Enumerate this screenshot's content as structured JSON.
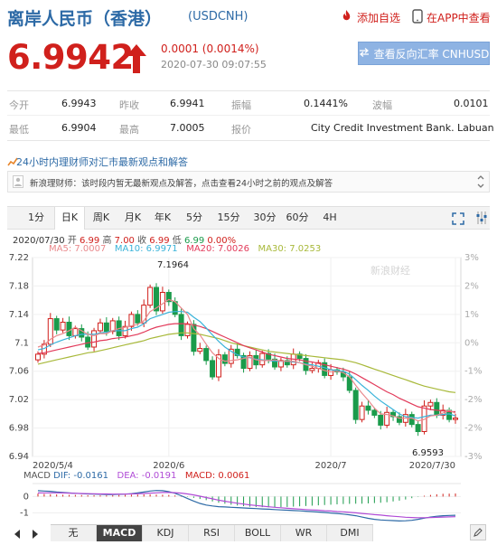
{
  "header": {
    "title": "离岸人民币（香港）",
    "code": "(USDCNH)",
    "add_watch": "添加自选",
    "app_view": "在APP中查看"
  },
  "quote": {
    "price": "6.9942",
    "change": "0.0001 (0.0014%)",
    "time": "2020-07-30 09:07:55",
    "reverse_button": "查看反向汇率 CNHUSD"
  },
  "stats": {
    "open_label": "今开",
    "open": "6.9943",
    "prev_close_label": "昨收",
    "prev_close": "6.9941",
    "amplitude_label": "振幅",
    "amplitude": "0.1441%",
    "volatility_label": "波幅",
    "volatility": "0.0101",
    "low_label": "最低",
    "low": "6.9904",
    "high_label": "最高",
    "high": "7.0005",
    "quoter_label": "报价",
    "quoter": "City Credit Investment Bank. Labuan"
  },
  "advisory": {
    "title": "24小时内理财师对汇市最新观点和解答",
    "message": "新浪理财师：该时段内暂无最新观点及解答，点击查看24小时之前的观点及解答"
  },
  "tabs": [
    "1分",
    "日K",
    "周K",
    "月K",
    "年K",
    "5分",
    "15分",
    "30分",
    "60分",
    "4H"
  ],
  "active_tab": "日K",
  "kline_info": {
    "date": "2020/07/30",
    "open_label": "开",
    "open": "6.99",
    "high_label": "高",
    "high": "7.00",
    "close_label": "收",
    "close": "6.99",
    "low_label": "低",
    "low": "6.99",
    "change": "0.00%",
    "ma5": "MA5: 7.0007",
    "ma10": "MA10: 6.9971",
    "ma20": "MA20: 7.0026",
    "ma30": "MA30: 7.0253"
  },
  "macd_info": {
    "label": "MACD",
    "dif": "DIF: -0.0161",
    "dea": "DEA: -0.0191",
    "macd": "MACD: 0.0061"
  },
  "watermark": "新浪财经",
  "indicator_tabs": [
    "无",
    "MACD",
    "KDJ",
    "RSI",
    "BOLL",
    "WR",
    "DMI"
  ],
  "active_indicator": "MACD",
  "colors": {
    "up": "#d0201c",
    "down": "#1a9b4b",
    "ma5": "#e9898c",
    "ma10": "#3ab3d9",
    "ma20": "#e23a5a",
    "ma30": "#a8b93a",
    "link": "#2d6aa6"
  },
  "chart_data": [
    {
      "type": "candlestick",
      "y_ticks": [
        "7.22",
        "7.18",
        "7.14",
        "7.1",
        "7.06",
        "7.02",
        "6.98",
        "6.94"
      ],
      "y_right_ticks": [
        "3%",
        "2%",
        "1%",
        "0%",
        "-1%",
        "-2%",
        "-2%",
        "-3%"
      ],
      "x_ticks": [
        "2020/5/4",
        "2020/6",
        "2020/7",
        "2020/7/30"
      ],
      "ylim": [
        6.94,
        7.22
      ],
      "annotations": {
        "max": "7.1964",
        "min": "6.9593"
      },
      "close": [
        7.084,
        7.098,
        7.134,
        7.118,
        7.129,
        7.11,
        7.12,
        7.108,
        7.094,
        7.117,
        7.128,
        7.116,
        7.131,
        7.11,
        7.123,
        7.14,
        7.128,
        7.153,
        7.178,
        7.145,
        7.171,
        7.158,
        7.14,
        7.11,
        7.126,
        7.088,
        7.092,
        7.075,
        7.052,
        7.083,
        7.071,
        7.091,
        7.082,
        7.064,
        7.082,
        7.069,
        7.085,
        7.077,
        7.066,
        7.075,
        7.069,
        7.084,
        7.078,
        7.061,
        7.064,
        7.072,
        7.054,
        7.062,
        7.059,
        7.052,
        7.033,
        6.992,
        7.011,
        7.005,
        6.998,
        6.984,
        7.002,
        6.996,
        6.988,
        6.999,
        6.985,
        6.975,
        7.011,
        7.016,
        6.998,
        7.005,
        6.992,
        6.994
      ],
      "ma5": [
        7.094,
        7.097,
        7.105,
        7.11,
        7.113,
        7.117,
        7.122,
        7.117,
        7.112,
        7.11,
        7.113,
        7.113,
        7.117,
        7.12,
        7.122,
        7.124,
        7.126,
        7.131,
        7.144,
        7.149,
        7.155,
        7.161,
        7.158,
        7.149,
        7.14,
        7.12,
        7.111,
        7.098,
        7.086,
        7.078,
        7.074,
        7.075,
        7.076,
        7.078,
        7.08,
        7.076,
        7.075,
        7.075,
        7.076,
        7.074,
        7.074,
        7.074,
        7.072,
        7.069,
        7.067,
        7.064,
        7.061,
        7.059,
        7.06,
        7.058,
        7.052,
        7.04,
        7.029,
        7.019,
        7.008,
        7.0,
        6.999,
        6.997,
        6.994,
        6.994,
        6.994,
        6.99,
        6.992,
        6.997,
        6.998,
        7.001,
        7.005,
        7.001
      ],
      "ma10": [
        7.09,
        7.092,
        7.097,
        7.101,
        7.104,
        7.107,
        7.11,
        7.112,
        7.112,
        7.112,
        7.114,
        7.115,
        7.117,
        7.117,
        7.117,
        7.12,
        7.122,
        7.127,
        7.134,
        7.137,
        7.14,
        7.143,
        7.144,
        7.144,
        7.143,
        7.136,
        7.13,
        7.121,
        7.111,
        7.102,
        7.094,
        7.088,
        7.083,
        7.08,
        7.079,
        7.077,
        7.076,
        7.075,
        7.074,
        7.074,
        7.074,
        7.073,
        7.072,
        7.07,
        7.069,
        7.067,
        7.065,
        7.062,
        7.061,
        7.06,
        7.056,
        7.048,
        7.04,
        7.033,
        7.025,
        7.018,
        7.012,
        7.006,
        7.0,
        6.996,
        6.995,
        6.994,
        6.996,
        6.998,
        6.998,
        6.999,
        7.0,
        6.997
      ],
      "ma20": [
        7.085,
        7.086,
        7.088,
        7.09,
        7.092,
        7.094,
        7.096,
        7.098,
        7.1,
        7.101,
        7.103,
        7.104,
        7.106,
        7.107,
        7.108,
        7.11,
        7.112,
        7.115,
        7.119,
        7.122,
        7.124,
        7.126,
        7.127,
        7.127,
        7.127,
        7.125,
        7.123,
        7.12,
        7.116,
        7.112,
        7.108,
        7.104,
        7.1,
        7.096,
        7.093,
        7.09,
        7.087,
        7.084,
        7.082,
        7.08,
        7.078,
        7.077,
        7.076,
        7.074,
        7.073,
        7.071,
        7.069,
        7.067,
        7.065,
        7.063,
        7.06,
        7.056,
        7.051,
        7.046,
        7.041,
        7.036,
        7.031,
        7.027,
        7.022,
        7.018,
        7.014,
        7.01,
        7.008,
        7.006,
        7.005,
        7.004,
        7.003,
        7.003
      ],
      "ma30": [
        7.07,
        7.072,
        7.074,
        7.076,
        7.078,
        7.08,
        7.082,
        7.084,
        7.086,
        7.087,
        7.089,
        7.091,
        7.093,
        7.095,
        7.097,
        7.099,
        7.101,
        7.103,
        7.106,
        7.108,
        7.11,
        7.112,
        7.113,
        7.114,
        7.114,
        7.113,
        7.112,
        7.11,
        7.108,
        7.106,
        7.103,
        7.1,
        7.098,
        7.096,
        7.094,
        7.092,
        7.09,
        7.088,
        7.087,
        7.086,
        7.085,
        7.084,
        7.083,
        7.082,
        7.081,
        7.08,
        7.079,
        7.078,
        7.077,
        7.076,
        7.074,
        7.072,
        7.069,
        7.066,
        7.063,
        7.06,
        7.057,
        7.054,
        7.051,
        7.048,
        7.045,
        7.042,
        7.039,
        7.037,
        7.035,
        7.033,
        7.031,
        7.03
      ]
    },
    {
      "type": "macd",
      "y_ticks": [
        "0",
        "-1"
      ],
      "ylim": [
        -1.7,
        0.8
      ],
      "hist": [
        0.18,
        0.16,
        0.14,
        0.13,
        0.11,
        0.1,
        0.1,
        0.09,
        0.08,
        0.08,
        0.07,
        0.07,
        0.08,
        0.09,
        0.1,
        0.11,
        0.12,
        0.13,
        0.13,
        0.12,
        0.11,
        0.1,
        0.07,
        0.03,
        -0.02,
        -0.08,
        -0.15,
        -0.22,
        -0.3,
        -0.38,
        -0.44,
        -0.5,
        -0.55,
        -0.59,
        -0.62,
        -0.64,
        -0.65,
        -0.66,
        -0.66,
        -0.65,
        -0.64,
        -0.62,
        -0.6,
        -0.58,
        -0.56,
        -0.54,
        -0.52,
        -0.5,
        -0.48,
        -0.46,
        -0.45,
        -0.44,
        -0.44,
        -0.42,
        -0.4,
        -0.38,
        -0.35,
        -0.3,
        -0.25,
        -0.18,
        -0.1,
        -0.02,
        0.05,
        0.1,
        0.14,
        0.17,
        0.18,
        0.19
      ],
      "dif": [
        0.36,
        0.34,
        0.32,
        0.28,
        0.25,
        0.22,
        0.2,
        0.18,
        0.16,
        0.15,
        0.14,
        0.13,
        0.13,
        0.14,
        0.15,
        0.18,
        0.22,
        0.28,
        0.34,
        0.37,
        0.36,
        0.3,
        0.2,
        0.05,
        -0.12,
        -0.28,
        -0.42,
        -0.52,
        -0.58,
        -0.62,
        -0.64,
        -0.66,
        -0.68,
        -0.7,
        -0.72,
        -0.74,
        -0.76,
        -0.78,
        -0.8,
        -0.82,
        -0.84,
        -0.86,
        -0.88,
        -0.9,
        -0.92,
        -0.95,
        -0.98,
        -1.01,
        -1.04,
        -1.08,
        -1.12,
        -1.18,
        -1.26,
        -1.34,
        -1.4,
        -1.44,
        -1.46,
        -1.48,
        -1.5,
        -1.49,
        -1.46,
        -1.4,
        -1.33,
        -1.26,
        -1.21,
        -1.18,
        -1.16,
        -1.15
      ],
      "dea": [
        0.22,
        0.23,
        0.23,
        0.23,
        0.22,
        0.21,
        0.2,
        0.19,
        0.18,
        0.17,
        0.16,
        0.16,
        0.15,
        0.15,
        0.15,
        0.16,
        0.17,
        0.19,
        0.21,
        0.23,
        0.25,
        0.25,
        0.24,
        0.21,
        0.16,
        0.1,
        0.02,
        -0.06,
        -0.14,
        -0.22,
        -0.29,
        -0.35,
        -0.41,
        -0.46,
        -0.51,
        -0.55,
        -0.59,
        -0.63,
        -0.66,
        -0.69,
        -0.72,
        -0.75,
        -0.77,
        -0.8,
        -0.82,
        -0.84,
        -0.87,
        -0.89,
        -0.92,
        -0.94,
        -0.97,
        -1.0,
        -1.04,
        -1.07,
        -1.11,
        -1.14,
        -1.18,
        -1.21,
        -1.24,
        -1.27,
        -1.29,
        -1.3,
        -1.3,
        -1.29,
        -1.28,
        -1.26,
        -1.25,
        -1.24
      ]
    }
  ]
}
